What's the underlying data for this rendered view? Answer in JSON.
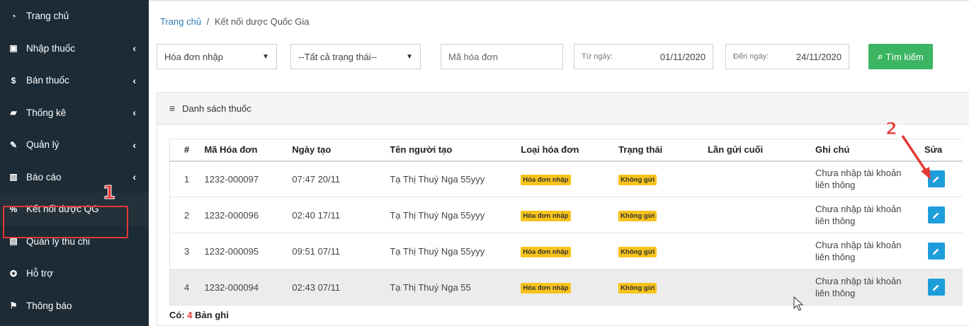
{
  "sidebar": {
    "items": [
      {
        "label": "Trang chủ",
        "icon": "dashboard-icon",
        "chev": ""
      },
      {
        "label": "Nhập thuốc",
        "icon": "import-icon",
        "chev": "‹"
      },
      {
        "label": "Bán thuốc",
        "icon": "dollar-icon",
        "chev": "‹"
      },
      {
        "label": "Thống kê",
        "icon": "folder-icon",
        "chev": "‹"
      },
      {
        "label": "Quản lý",
        "icon": "edit-icon",
        "chev": "‹"
      },
      {
        "label": "Báo cáo",
        "icon": "chart-icon",
        "chev": "‹"
      },
      {
        "label": "Kết nối dược QG",
        "icon": "link-icon",
        "chev": ""
      },
      {
        "label": "Quản lý thu chi",
        "icon": "money-icon",
        "chev": ""
      },
      {
        "label": "Hỗ trợ",
        "icon": "support-icon",
        "chev": ""
      },
      {
        "label": "Thông báo",
        "icon": "flag-icon",
        "chev": ""
      }
    ]
  },
  "annotations": {
    "one": "1",
    "two": "2"
  },
  "breadcrumb": {
    "home": "Trang chủ",
    "sep": "/",
    "current": "Kết nối dược Quốc Gia"
  },
  "filters": {
    "invoice_type": "Hóa đơn nhập",
    "status": "--Tất cả trạng thái--",
    "invoice_code_placeholder": "Mã hóa đơn",
    "from_label": "Từ ngày:",
    "from_value": "01/11/2020",
    "to_label": "Đến ngày:",
    "to_value": "24/11/2020",
    "search_label": "Tìm kiếm"
  },
  "panel": {
    "title": "Danh sách thuốc"
  },
  "table": {
    "headers": [
      "#",
      "Mã Hóa đơn",
      "Ngày tạo",
      "Tên người tạo",
      "Loại hóa đơn",
      "Trạng thái",
      "Lần gửi cuối",
      "Ghi chú",
      "Sửa"
    ],
    "rows": [
      {
        "idx": "1",
        "code": "1232-000097",
        "date": "07:47 20/11",
        "user": "Tạ Thị Thuý Nga 55yyy",
        "type": "Hóa đơn nhập",
        "status": "Không gửi",
        "last": "",
        "note": "Chưa nhập tài khoản liên thông"
      },
      {
        "idx": "2",
        "code": "1232-000096",
        "date": "02:40 17/11",
        "user": "Tạ Thị Thuý Nga 55yyy",
        "type": "Hóa đơn nhập",
        "status": "Không gửi",
        "last": "",
        "note": "Chưa nhập tài khoản liên thông"
      },
      {
        "idx": "3",
        "code": "1232-000095",
        "date": "09:51 07/11",
        "user": "Tạ Thị Thuý Nga 55yyy",
        "type": "Hóa đơn nhập",
        "status": "Không gửi",
        "last": "",
        "note": "Chưa nhập tài khoản liên thông"
      },
      {
        "idx": "4",
        "code": "1232-000094",
        "date": "02:43 07/11",
        "user": "Tạ Thị Thuý Nga 55",
        "type": "Hóa đơn nhập",
        "status": "Không gửi",
        "last": "",
        "note": "Chưa nhập tài khoản liên thông"
      }
    ]
  },
  "footer": {
    "prefix": "Có:",
    "count": "4",
    "suffix": "Bản ghi"
  },
  "colors": {
    "sidebar": "#1c2b36",
    "accent": "#1e9ddb",
    "search": "#3cb563",
    "tag": "#f7c31b",
    "annotation": "#e53935"
  }
}
